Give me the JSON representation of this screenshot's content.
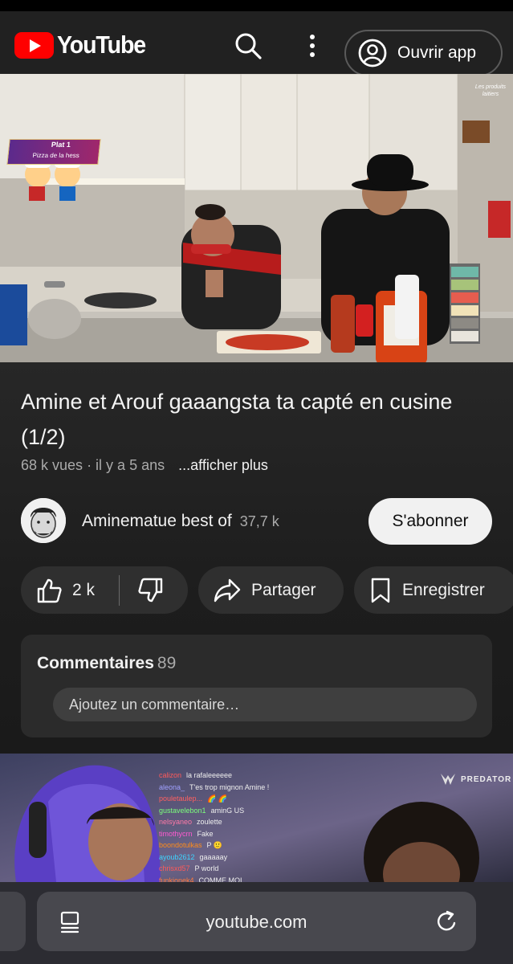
{
  "header": {
    "logo_text": "YouTube",
    "open_app_label": "Ouvrir app"
  },
  "video": {
    "overlay_badge": "Plat 1",
    "overlay_subtitle": "Pizza de la hess",
    "watermark": "Les produits laitiers"
  },
  "details": {
    "title": "Amine et Arouf gaaangsta ta capté en cusine (1/2)",
    "views": "68 k vues",
    "age": "· il y a 5 ans",
    "more_label": "...afficher plus"
  },
  "channel": {
    "name": "Aminematue best of",
    "subscribers": "37,7 k",
    "subscribe_label": "S'abonner"
  },
  "actions": {
    "likes": "2 k",
    "share_label": "Partager",
    "save_label": "Enregistrer"
  },
  "comments": {
    "heading": "Commentaires",
    "count": "89",
    "input_placeholder": "Ajoutez un commentaire…"
  },
  "next_video": {
    "brand": "PREDATOR",
    "chat": [
      {
        "user": "calizon",
        "message": "la rafaleeeeee",
        "color": "#ff5a5a"
      },
      {
        "user": "aleona_",
        "message": "T'es trop mignon Amine !",
        "color": "#a0a0ff"
      },
      {
        "user": "pouletaulep...",
        "message": "🌈 🌈",
        "color": "#ff6060"
      },
      {
        "user": "gustavelebon1",
        "message": "aminG US",
        "color": "#7cff7c"
      },
      {
        "user": "nelsyaneo",
        "message": "zoulette",
        "color": "#ff7aa8"
      },
      {
        "user": "timothycrn",
        "message": "Fake",
        "color": "#ff5ad0"
      },
      {
        "user": "boondotulkas",
        "message": "P 🙂",
        "color": "#ff8c1a"
      },
      {
        "user": "ayoub2612",
        "message": "gaaaaay",
        "color": "#3cd4ff"
      },
      {
        "user": "chrisxd57",
        "message": "P world",
        "color": "#ff5a5a"
      },
      {
        "user": "funkionek4",
        "message": "COMME MOI",
        "color": "#ff7a3c"
      }
    ]
  },
  "browser": {
    "url": "youtube.com"
  },
  "colors": {
    "brand_red": "#ff0000",
    "background": "#0f0f0f",
    "pill": "#2f2f2f"
  }
}
